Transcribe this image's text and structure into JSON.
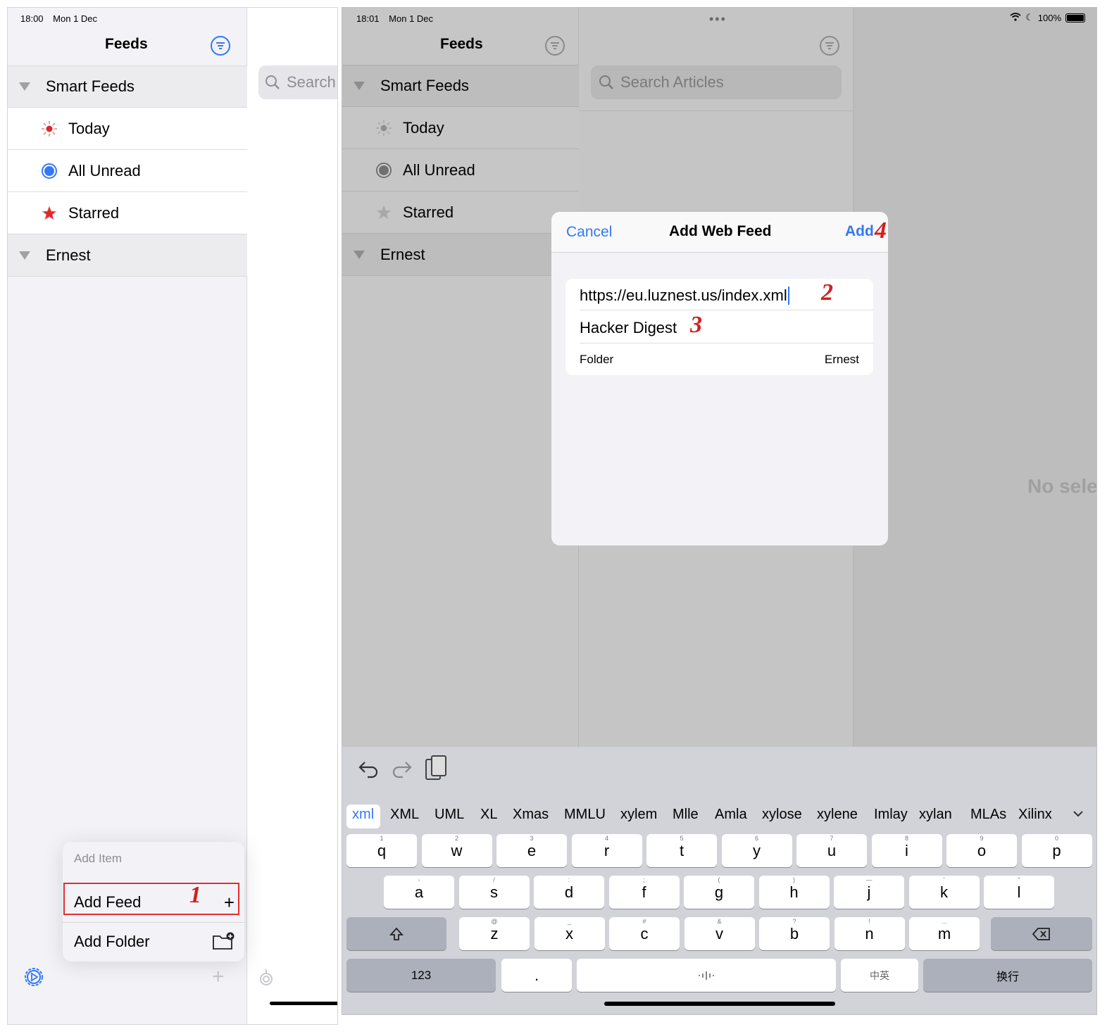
{
  "left_screen": {
    "status": {
      "time": "18:00",
      "date": "Mon 1 Dec"
    },
    "nav_title": "Feeds",
    "search_placeholder": "Search",
    "sections": [
      {
        "label": "Smart Feeds"
      },
      {
        "label": "Ernest"
      }
    ],
    "smart_feeds": [
      {
        "label": "Today",
        "icon": "sun-icon"
      },
      {
        "label": "All Unread",
        "icon": "unread-circle-icon"
      },
      {
        "label": "Starred",
        "icon": "star-icon"
      }
    ],
    "add_menu": {
      "header": "Add Item",
      "add_feed": "Add Feed",
      "add_folder": "Add Folder"
    },
    "markers": {
      "add_feed": "1"
    }
  },
  "right_screen": {
    "status": {
      "time": "18:01",
      "date": "Mon 1 Dec",
      "battery": "100%"
    },
    "nav_title": "Feeds",
    "search_placeholder": "Search Articles",
    "detail_text": "No sele",
    "sections": [
      {
        "label": "Smart Feeds"
      },
      {
        "label": "Ernest"
      }
    ],
    "smart_feeds": [
      {
        "label": "Today"
      },
      {
        "label": "All Unread"
      },
      {
        "label": "Starred"
      }
    ],
    "dialog": {
      "cancel": "Cancel",
      "title": "Add Web Feed",
      "add": "Add",
      "url_value": "https://eu.luznest.us/index.xml",
      "name_value": "Hacker Digest",
      "folder_label": "Folder",
      "folder_value": "Ernest"
    },
    "markers": {
      "url": "2",
      "name": "3",
      "add": "4"
    },
    "keyboard": {
      "suggestions": [
        "xml",
        "XML",
        "UML",
        "XL",
        "Xmas",
        "MMLU",
        "xylem",
        "Mlle",
        "Amla",
        "xylose",
        "xylene",
        "Imlay",
        "xylan",
        "MLAs",
        "Xilinx"
      ],
      "row1": [
        "q",
        "w",
        "e",
        "r",
        "t",
        "y",
        "u",
        "i",
        "o",
        "p"
      ],
      "row1_sub": [
        "1",
        "2",
        "3",
        "4",
        "5",
        "6",
        "7",
        "8",
        "9",
        "0"
      ],
      "row2": [
        "a",
        "s",
        "d",
        "f",
        "g",
        "h",
        "j",
        "k",
        "l"
      ],
      "row2_sub": [
        "-",
        "/",
        ":",
        ";",
        "(",
        ")",
        "—",
        "'",
        "\""
      ],
      "row3": [
        "z",
        "x",
        "c",
        "v",
        "b",
        "n",
        "m"
      ],
      "row3_sub": [
        "@",
        "_",
        "#",
        "&",
        "?",
        "!",
        "…"
      ],
      "numbers_key": "123",
      "dot_key": ".",
      "lang_key": "中英",
      "return_key": "换行"
    }
  },
  "colors": {
    "accent": "#3478f6",
    "marker": "#d21e1e",
    "today_red": "#e0282a"
  }
}
